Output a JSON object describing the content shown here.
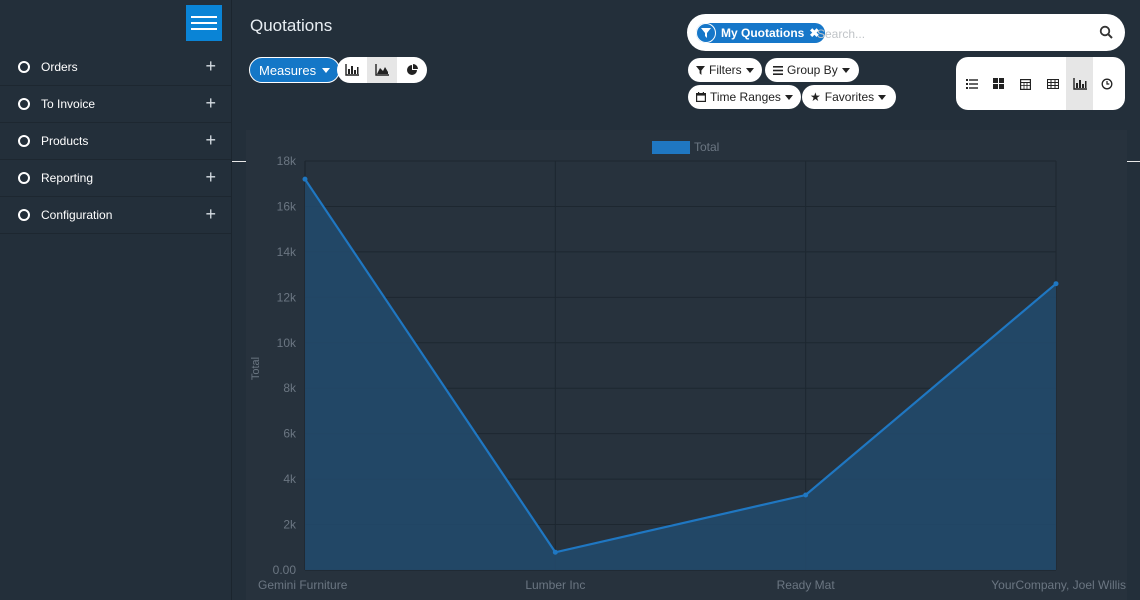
{
  "sidebar": {
    "menu_items": [
      {
        "label": "Orders"
      },
      {
        "label": "To Invoice"
      },
      {
        "label": "Products"
      },
      {
        "label": "Reporting"
      },
      {
        "label": "Configuration"
      }
    ]
  },
  "page": {
    "title": "Quotations"
  },
  "search": {
    "facet_label": "My Quotations",
    "placeholder": "Search..."
  },
  "toolbar": {
    "measures_label": "Measures",
    "filters_label": "Filters",
    "group_by_label": "Group By",
    "time_ranges_label": "Time Ranges",
    "favorites_label": "Favorites",
    "chart_types": [
      "bar-chart-icon",
      "line-chart-icon",
      "pie-chart-icon"
    ],
    "active_chart_type": "line",
    "views": [
      "list-icon",
      "kanban-icon",
      "calendar-icon",
      "pivot-icon",
      "graph-icon",
      "activity-icon"
    ],
    "active_view": "graph"
  },
  "colors": {
    "accent": "#1477c7",
    "series": "#1f77c2"
  },
  "chart_data": {
    "type": "area",
    "categories": [
      "Gemini Furniture",
      "Lumber Inc",
      "Ready Mat",
      "YourCompany, Joel Willis"
    ],
    "series": [
      {
        "name": "Total",
        "values": [
          17200,
          780,
          3300,
          12600
        ]
      }
    ],
    "ylabel": "Total",
    "ylim": [
      0,
      18000
    ],
    "yticks": [
      "0.00",
      "2k",
      "4k",
      "6k",
      "8k",
      "10k",
      "12k",
      "14k",
      "16k",
      "18k"
    ],
    "grid": true,
    "legend": "top"
  }
}
